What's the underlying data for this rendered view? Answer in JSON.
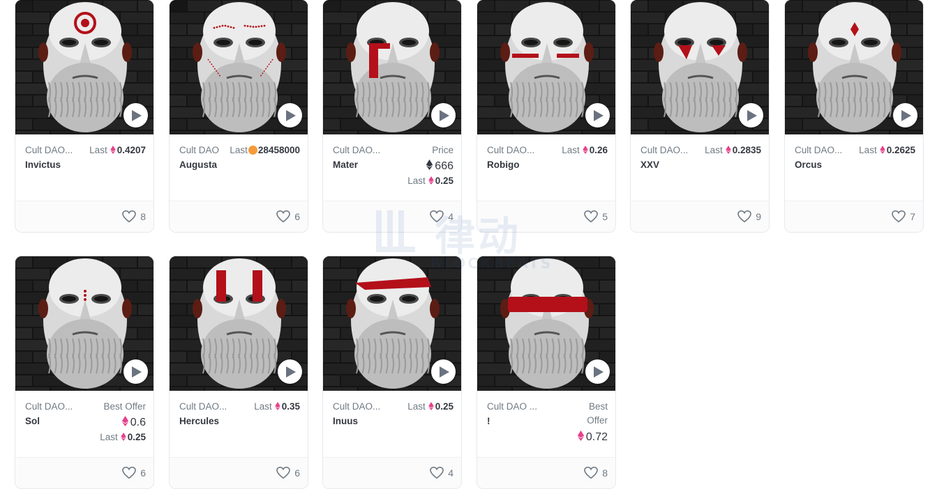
{
  "colors": {
    "eth_pink": "#e6428b",
    "eth_dark": "#353840",
    "text_muted": "#707a83",
    "text_dark": "#353840"
  },
  "watermark": {
    "cn": "律动",
    "en": "BLOCKBEATS"
  },
  "cards": [
    {
      "collection": "Cult DAO...",
      "name": "Invictus",
      "last_label": "Last",
      "last_value": "0.4207",
      "likes": "8",
      "paint": "target"
    },
    {
      "collection": "Cult DAO",
      "name": "Augusta",
      "last_label": "Last",
      "last_value": "28458000",
      "likes": "6",
      "paint": "dots"
    },
    {
      "collection": "Cult DAO...",
      "name": "Mater",
      "price_label": "Price",
      "price_value": "666",
      "last_label": "Last",
      "last_value": "0.25",
      "likes": "4",
      "paint": "stripe-left"
    },
    {
      "collection": "Cult DAO...",
      "name": "Robigo",
      "last_label": "Last",
      "last_value": "0.26",
      "likes": "5",
      "paint": "eyelines"
    },
    {
      "collection": "Cult DAO...",
      "name": "XXV",
      "last_label": "Last",
      "last_value": "0.2835",
      "likes": "9",
      "paint": "tears"
    },
    {
      "collection": "Cult DAO...",
      "name": "Orcus",
      "last_label": "Last",
      "last_value": "0.2625",
      "likes": "7",
      "paint": "diamond"
    },
    {
      "collection": "Cult DAO...",
      "name": "Sol",
      "offer_label": "Best Offer",
      "offer_value": "0.6",
      "last_label": "Last",
      "last_value": "0.25",
      "likes": "6",
      "paint": "threedots"
    },
    {
      "collection": "Cult DAO...",
      "name": "Hercules",
      "last_label": "Last",
      "last_value": "0.35",
      "likes": "6",
      "paint": "twobars"
    },
    {
      "collection": "Cult DAO...",
      "name": "Inuus",
      "last_label": "Last",
      "last_value": "0.25",
      "likes": "4",
      "paint": "headband"
    },
    {
      "collection": "Cult DAO ...",
      "name": "!",
      "offer_label_1": "Best",
      "offer_label_2": "Offer",
      "offer_value": "0.72",
      "likes": "8",
      "paint": "mask"
    }
  ]
}
